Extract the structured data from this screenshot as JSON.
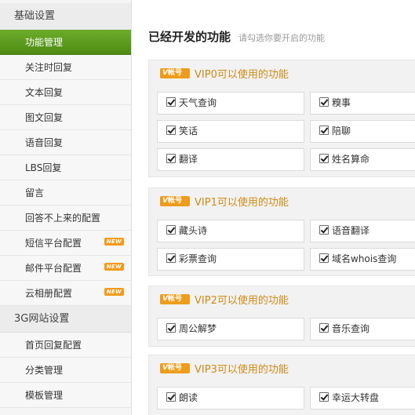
{
  "sidebar": {
    "groups": [
      {
        "title": "基础设置",
        "items": [
          {
            "label": "功能管理"
          },
          {
            "label": "关注时回复"
          },
          {
            "label": "文本回复"
          },
          {
            "label": "图文回复"
          },
          {
            "label": "语音回复"
          },
          {
            "label": "LBS回复"
          },
          {
            "label": "留言"
          },
          {
            "label": "回答不上来的配置"
          },
          {
            "label": "短信平台配置",
            "badge": "NEW"
          },
          {
            "label": "邮件平台配置",
            "badge": "NEW"
          },
          {
            "label": "云相册配置",
            "badge": "NEW"
          }
        ]
      },
      {
        "title": "3G网站设置",
        "items": [
          {
            "label": "首页回复配置"
          },
          {
            "label": "分类管理"
          },
          {
            "label": "模板管理"
          }
        ]
      }
    ]
  },
  "main": {
    "title": "已经开发的功能",
    "hint": "请勾选你要开启的功能",
    "tag_text": "帐号",
    "sections": [
      {
        "label": "VIP0可以使用的功能",
        "features": [
          "天气查询",
          "糗事",
          "笑话",
          "陪聊",
          "翻译",
          "姓名算命"
        ]
      },
      {
        "label": "VIP1可以使用的功能",
        "features": [
          "藏头诗",
          "语音翻译",
          "彩票查询",
          "域名whois查询"
        ]
      },
      {
        "label": "VIP2可以使用的功能",
        "features": [
          "周公解梦",
          "音乐查询"
        ]
      },
      {
        "label": "VIP3可以使用的功能",
        "features": [
          "朗读",
          "幸运大转盘"
        ]
      }
    ]
  },
  "colors": {
    "active_green": "#5a9a1e",
    "section_label": "#d08a16",
    "tag_orange": "#ee9c1c",
    "new_badge": "#f39a1b"
  },
  "icons": {
    "tag": "vip-account-tag-icon",
    "checkbox": "checkbox-checked-icon",
    "badge": "new-badge"
  }
}
